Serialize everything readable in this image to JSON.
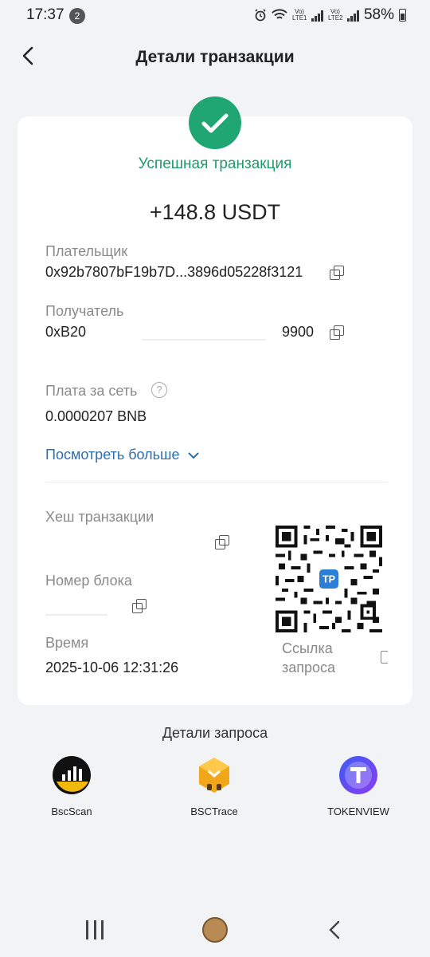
{
  "status_bar": {
    "time": "17:37",
    "notification_count": "2",
    "sim1": "Vo) LTE1",
    "sim2": "Vo) LTE2",
    "battery": "58%"
  },
  "header": {
    "title": "Детали транзакции"
  },
  "transaction": {
    "status": "Успешная транзакция",
    "amount": "+148.8 USDT",
    "payer_label": "Плательщик",
    "payer_value": "0x92b7807bF19b7D...3896d05228f3121",
    "recipient_label": "Получатель",
    "recipient_prefix": "0xB20",
    "recipient_suffix": "9900",
    "fee_label": "Плата за сеть",
    "fee_help": "?",
    "fee_value": "0.0000207 BNB",
    "more_label": "Посмотреть больше",
    "hash_label": "Хеш транзакции",
    "block_label": "Номер блока",
    "time_label": "Время",
    "time_value": "2025-10-06 12:31:26",
    "qr_badge": "TP",
    "qr_caption_line1": "Ссылка",
    "qr_caption_line2": "запроса"
  },
  "query_details": {
    "title": "Детали запроса",
    "explorers": [
      {
        "name": "BscScan",
        "icon": "bscscan-logo"
      },
      {
        "name": "BSCTrace",
        "icon": "bsctrace-logo"
      },
      {
        "name": "TOKENVIEW",
        "icon": "tokenview-logo"
      }
    ]
  },
  "colors": {
    "success": "#1fa672",
    "link": "#2a6fb0",
    "background": "#f2f3f5",
    "card": "#ffffff"
  }
}
